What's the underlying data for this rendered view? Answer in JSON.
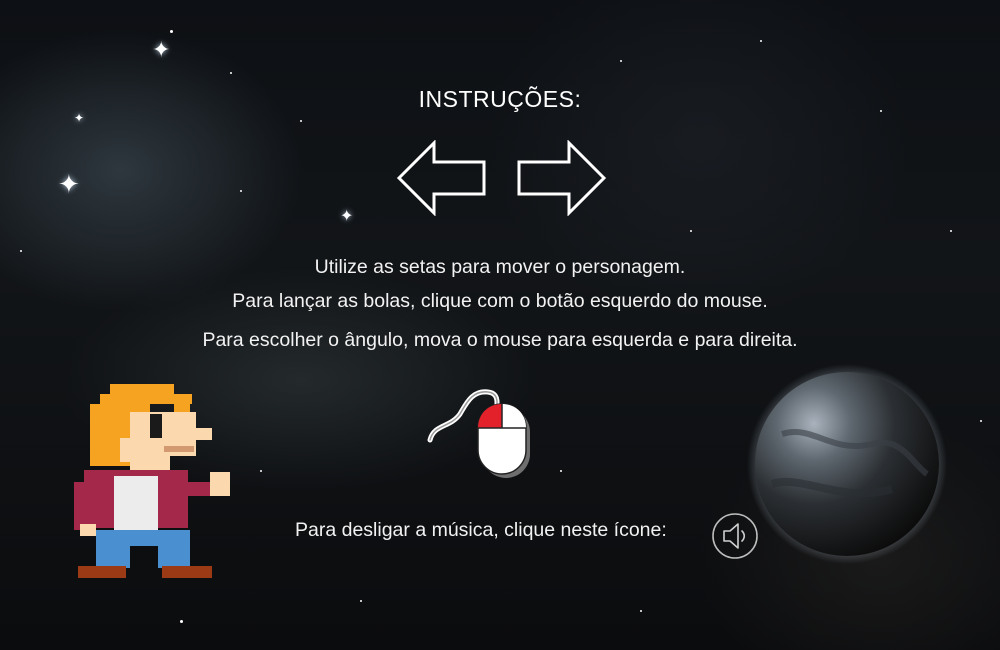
{
  "instructions": {
    "title": "INSTRUÇÕES:",
    "line1": "Utilize as setas para mover o personagem.",
    "line2": "Para lançar as bolas, clique com o botão esquerdo do mouse.",
    "line3": "Para escolher o ângulo, mova o mouse para esquerda e para direita.",
    "music": "Para desligar a música, clique neste ícone:"
  },
  "icons": {
    "left_arrow": "left-arrow-icon",
    "right_arrow": "right-arrow-icon",
    "mouse": "mouse-icon",
    "speaker": "speaker-icon"
  },
  "colors": {
    "text": "#f2f2f2",
    "mouse_button": "#e3212b",
    "hero_hair": "#f6a321",
    "hero_jacket": "#a3284a",
    "hero_pants": "#4a8fd0"
  }
}
